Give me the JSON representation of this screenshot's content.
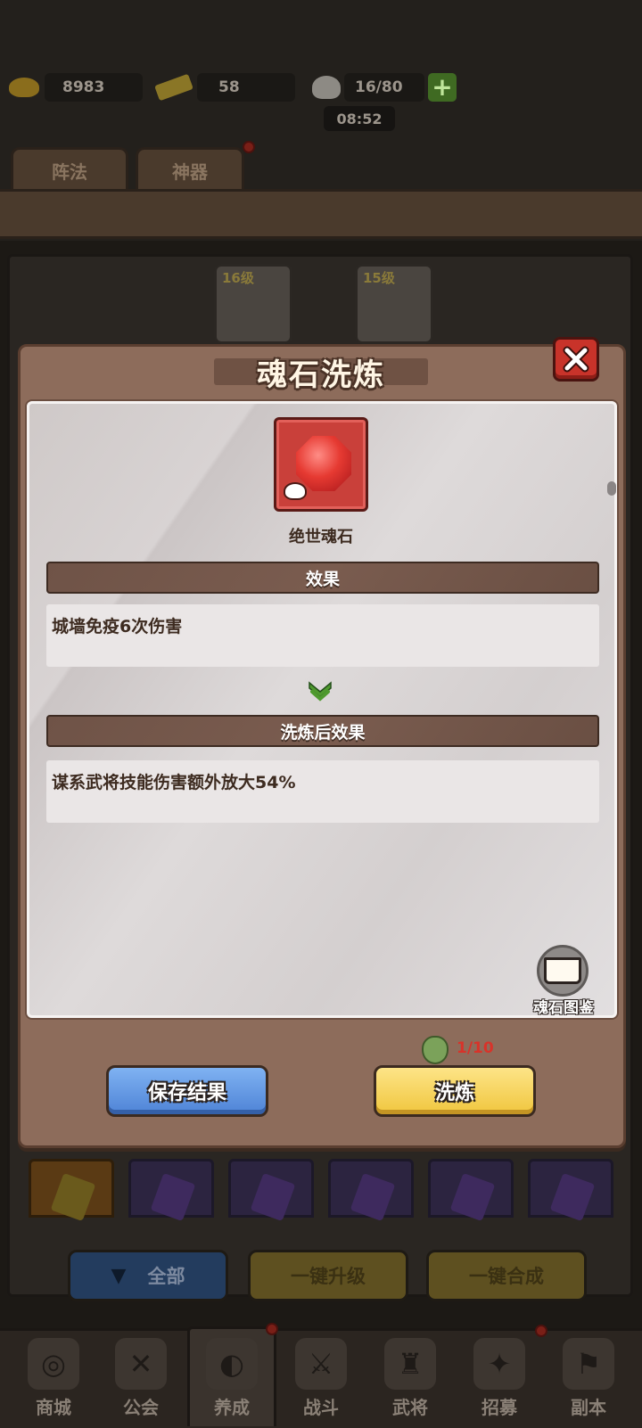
{
  "header": {
    "gold": "8983",
    "tickets": "58",
    "stamina": "16/80",
    "timer": "08:52",
    "tabs": [
      "阵法",
      "神器"
    ]
  },
  "heroes": [
    {
      "level": "16级"
    },
    {
      "level": "15级"
    }
  ],
  "modal": {
    "title": "魂石洗炼",
    "item_name": "绝世魂石",
    "effect_header": "效果",
    "current_effect": "城墙免疫6次伤害",
    "after_header": "洗炼后效果",
    "after_effect": "谋系武将技能伤害额外放大54%",
    "codex_label": "魂石图鉴",
    "cost": "1/10",
    "save_button": "保存结果",
    "refine_button": "洗炼"
  },
  "bottom_buttons": {
    "all": "全部",
    "upgrade_all": "一键升级",
    "merge_all": "一键合成"
  },
  "nav": [
    {
      "label": "商城"
    },
    {
      "label": "公会"
    },
    {
      "label": "养成"
    },
    {
      "label": "战斗"
    },
    {
      "label": "武将"
    },
    {
      "label": "招募"
    },
    {
      "label": "副本"
    }
  ],
  "colors": {
    "modal_bg": "#8d6c5b",
    "close_red": "#c8332a",
    "save_blue": "#4e83d6",
    "refine_yellow": "#f0c63e",
    "cost_red": "#d8332a",
    "gem_red": "#e63a32"
  }
}
